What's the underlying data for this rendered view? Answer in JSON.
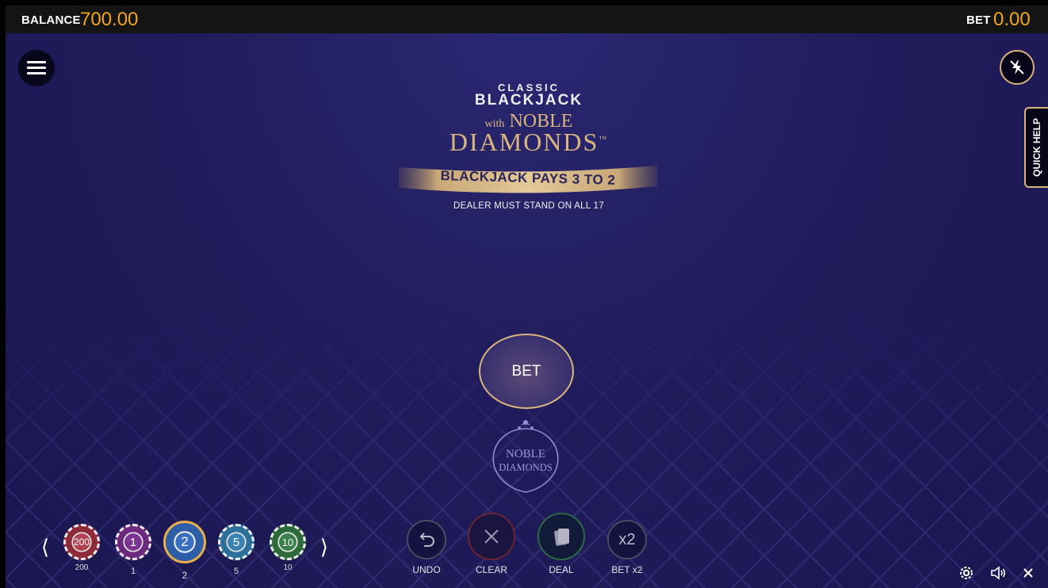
{
  "topbar": {
    "balance_label": "BALANCE",
    "balance_value": "700.00",
    "bet_label": "BET",
    "bet_value": "0.00"
  },
  "side": {
    "quick_help": "QUICK HELP"
  },
  "logo": {
    "classic": "CLASSIC",
    "blackjack": "BLACKJACK",
    "with": "with",
    "noble": "NOBLE",
    "diamonds": "DIAMONDS",
    "tm": "™",
    "pays": "BLACKJACK PAYS 3 TO 2",
    "stand": "DEALER MUST STAND ON ALL 17"
  },
  "table": {
    "bet_spot": "BET",
    "side_bet_line1": "NOBLE",
    "side_bet_line2": "DIAMONDS"
  },
  "chips": [
    {
      "face": "200",
      "label": "200",
      "color": "#8e2a3a",
      "selected": false
    },
    {
      "face": "1",
      "label": "1",
      "color": "#6b2a7e",
      "selected": false
    },
    {
      "face": "2",
      "label": "2",
      "color": "#2f5ea8",
      "selected": true
    },
    {
      "face": "5",
      "label": "5",
      "color": "#2e6f9a",
      "selected": false
    },
    {
      "face": "10",
      "label": "10",
      "color": "#2e6b3b",
      "selected": false
    }
  ],
  "actions": {
    "undo": "UNDO",
    "clear": "CLEAR",
    "deal": "DEAL",
    "double_label": "BET x2",
    "double_icon": "x2"
  },
  "colors": {
    "accent": "#f2a61d",
    "gold": "#d9b57f"
  }
}
